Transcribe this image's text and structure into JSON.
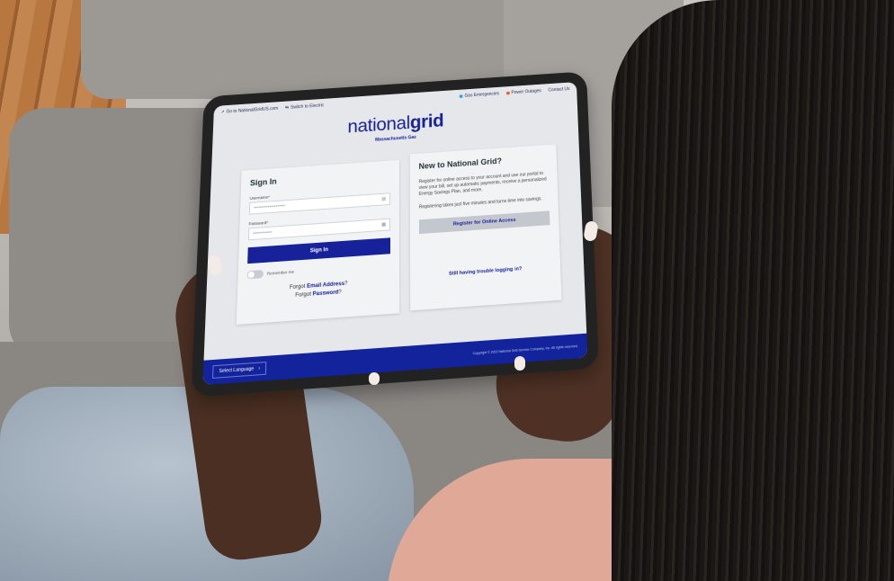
{
  "colors": {
    "brand_blue": "#16219a",
    "footer_blue": "#12239c",
    "screen_bg": "#e6e7ea"
  },
  "topbar": {
    "left_links": [
      {
        "label": "Go to NationalGridUS.com",
        "icon": "external-link-icon"
      },
      {
        "label": "Switch to Electric",
        "icon": "switch-icon"
      }
    ],
    "right_links": [
      {
        "label": "Gas Emergencies",
        "dot_color": "#3aa0d8"
      },
      {
        "label": "Power Outages",
        "dot_color": "#e0663a"
      },
      {
        "label": "Contact Us",
        "dot_color": ""
      }
    ]
  },
  "logo": {
    "light": "national",
    "bold": "grid",
    "subtitle": "Massachusetts Gas"
  },
  "signin": {
    "title": "Sign In",
    "username_label": "Username*",
    "username_value": "••••••••••••••••••••",
    "password_label": "Password*",
    "password_value": "••••••••••••",
    "button": "Sign In",
    "remember": "Remember me",
    "forgot_email_prefix": "Forgot",
    "forgot_email_link": "Email Address",
    "forgot_password_prefix": "Forgot",
    "forgot_password_link": "Password"
  },
  "newcard": {
    "title": "New to National Grid?",
    "para1": "Register for online access to your account and use our portal to view your bill, set up automatic payments, receive a personalized Energy Savings Plan, and more.",
    "para2": "Registering takes just five minutes and turns time into savings.",
    "button": "Register for Online Access",
    "trouble": "Still having trouble logging in?"
  },
  "footer": {
    "language": "Select Language",
    "copyright": "Copyright © 2022 National Grid Service Company, Inc. All rights reserved."
  }
}
